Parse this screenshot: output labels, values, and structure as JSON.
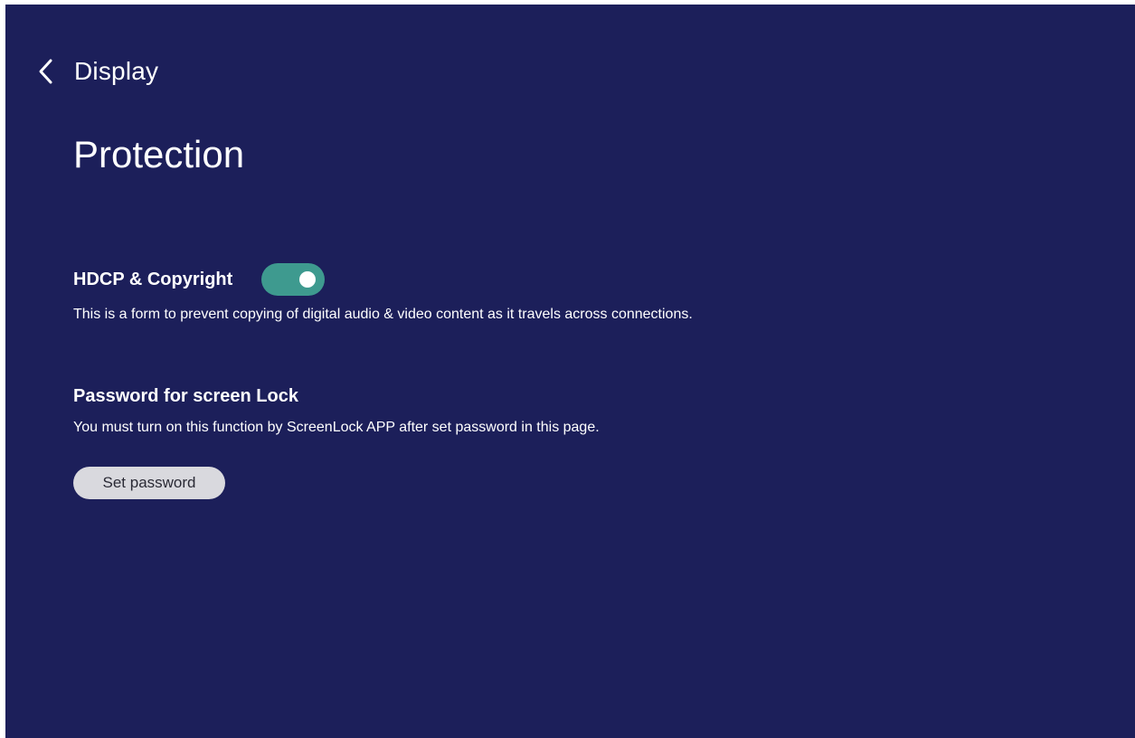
{
  "header": {
    "back_label": "Display"
  },
  "page": {
    "title": "Protection"
  },
  "hdcp": {
    "title": "HDCP & Copyright",
    "enabled": true,
    "description": "This is a form to prevent copying of digital audio & video content as it travels across connections."
  },
  "password": {
    "title": "Password for screen Lock",
    "description": "You must turn on this function by ScreenLock APP after set password in this page.",
    "button_label": "Set password"
  },
  "colors": {
    "background": "#1c1f5a",
    "toggle_on": "#3e9a8f",
    "button_bg": "#d9d9de"
  },
  "icons": {
    "back": "chevron-left-icon"
  }
}
